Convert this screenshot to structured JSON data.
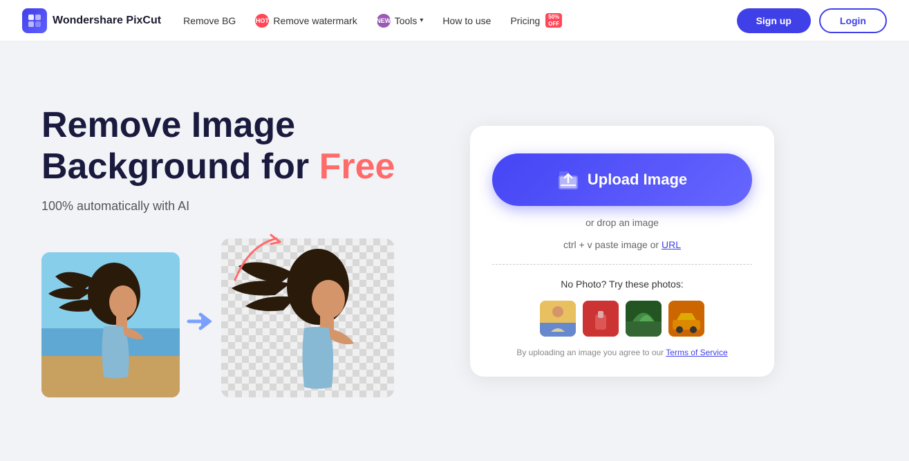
{
  "navbar": {
    "logo_text": "Wondershare PixCut",
    "links": [
      {
        "id": "remove-bg",
        "label": "Remove BG",
        "badge": null
      },
      {
        "id": "remove-watermark",
        "label": "Remove watermark",
        "badge": "hot"
      },
      {
        "id": "tools",
        "label": "Tools",
        "badge": "new",
        "has_dropdown": true
      },
      {
        "id": "how-to-use",
        "label": "How to use",
        "badge": null
      },
      {
        "id": "pricing",
        "label": "Pricing",
        "badge": "discount",
        "badge_text": "50%\nOFF"
      }
    ],
    "signup_label": "Sign up",
    "login_label": "Login"
  },
  "hero": {
    "title_line1": "Remove Image",
    "title_line2": "Background for ",
    "title_free": "Free",
    "subtitle": "100% automatically with AI"
  },
  "upload_panel": {
    "upload_button_label": "Upload Image",
    "drop_text": "or drop an image",
    "paste_text": "ctrl + v paste image or ",
    "paste_url_label": "URL",
    "sample_photos_label": "No Photo? Try these photos:",
    "terms_prefix": "By uploading an image you agree to our ",
    "terms_link_label": "Terms of Service"
  }
}
